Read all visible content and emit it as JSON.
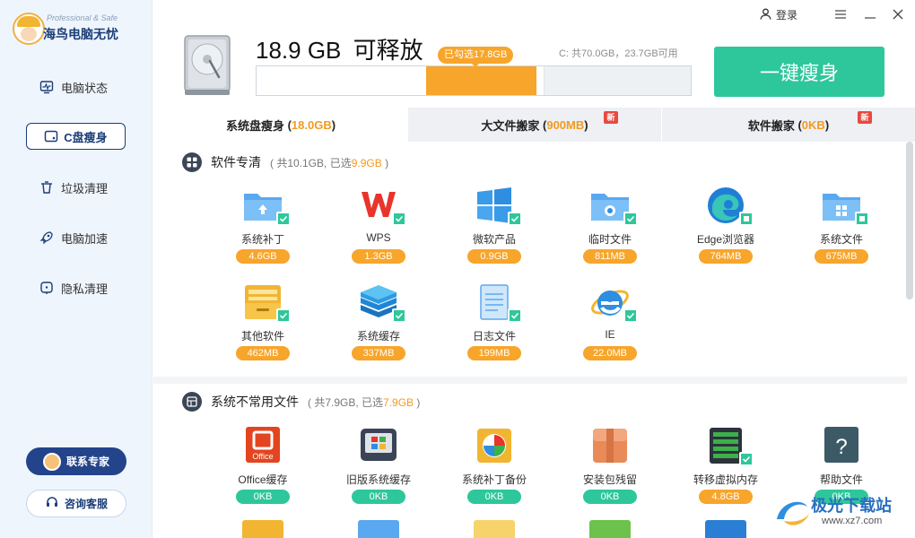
{
  "app": {
    "logo_subtitle": "Professional & Safe",
    "logo_title": "海鸟电脑无忧"
  },
  "sidebar": {
    "items": [
      {
        "label": "电脑状态",
        "icon": "monitor-pulse-icon"
      },
      {
        "label": "C盘瘦身",
        "icon": "drive-c-icon",
        "active": true
      },
      {
        "label": "垃圾清理",
        "icon": "trash-icon"
      },
      {
        "label": "电脑加速",
        "icon": "rocket-icon"
      },
      {
        "label": "隐私清理",
        "icon": "privacy-icon"
      }
    ],
    "expert_button": "联系专家",
    "service_button": "咨询客服"
  },
  "header": {
    "free_amount": "18.9 GB",
    "free_label": "可释放",
    "capacity": "C: 共70.0GB，23.7GB可用",
    "selected_tag": "已勾选17.8GB",
    "slim_button": "一键瘦身",
    "login": "登录"
  },
  "tabs": [
    {
      "label": "系统盘瘦身",
      "value": "18.0GB",
      "active": true,
      "new": false
    },
    {
      "label": "大文件搬家",
      "value": "900MB",
      "active": false,
      "new": true,
      "new_label": "新"
    },
    {
      "label": "软件搬家",
      "value": "0KB",
      "active": false,
      "new": true,
      "new_label": "新"
    }
  ],
  "sections": [
    {
      "title": "软件专清",
      "meta_prefix": "( 共10.1GB, 已选",
      "meta_selected": "9.9GB",
      "meta_suffix": " )",
      "items": [
        {
          "label": "系统补丁",
          "size": "4.6GB",
          "icon": "folder-upload-icon"
        },
        {
          "label": "WPS",
          "size": "1.3GB",
          "icon": "wps-icon"
        },
        {
          "label": "微软产品",
          "size": "0.9GB",
          "icon": "windows-icon"
        },
        {
          "label": "临时文件",
          "size": "811MB",
          "icon": "folder-edge-icon"
        },
        {
          "label": "Edge浏览器",
          "size": "764MB",
          "icon": "edge-icon"
        },
        {
          "label": "系统文件",
          "size": "675MB",
          "icon": "folder-windows-icon"
        },
        {
          "label": "其他软件",
          "size": "462MB",
          "icon": "yellow-folder-icon"
        },
        {
          "label": "系统缓存",
          "size": "337MB",
          "icon": "layers-icon"
        },
        {
          "label": "日志文件",
          "size": "199MB",
          "icon": "notepad-icon"
        },
        {
          "label": "IE",
          "size": "22.0MB",
          "icon": "ie-icon"
        }
      ]
    },
    {
      "title": "系统不常用文件",
      "meta_prefix": "( 共7.9GB, 已选",
      "meta_selected": "7.9GB",
      "meta_suffix": " )",
      "items": [
        {
          "label": "Office缓存",
          "size": "0KB",
          "icon": "office-icon"
        },
        {
          "label": "旧版系统缓存",
          "size": "0KB",
          "icon": "old-windows-icon"
        },
        {
          "label": "系统补丁备份",
          "size": "0KB",
          "icon": "patch-backup-icon"
        },
        {
          "label": "安装包残留",
          "size": "0KB",
          "icon": "package-box-icon"
        },
        {
          "label": "转移虚拟内存",
          "size": "4.8GB",
          "icon": "memory-chip-icon"
        },
        {
          "label": "帮助文件",
          "size": "0KB",
          "icon": "help-icon"
        }
      ]
    }
  ],
  "colors": {
    "accent_green": "#2ec79b",
    "accent_orange": "#f7a52b",
    "brand_navy": "#1b3d78"
  },
  "watermark": {
    "text": "极光下载站",
    "url": "www.xz7.com"
  }
}
